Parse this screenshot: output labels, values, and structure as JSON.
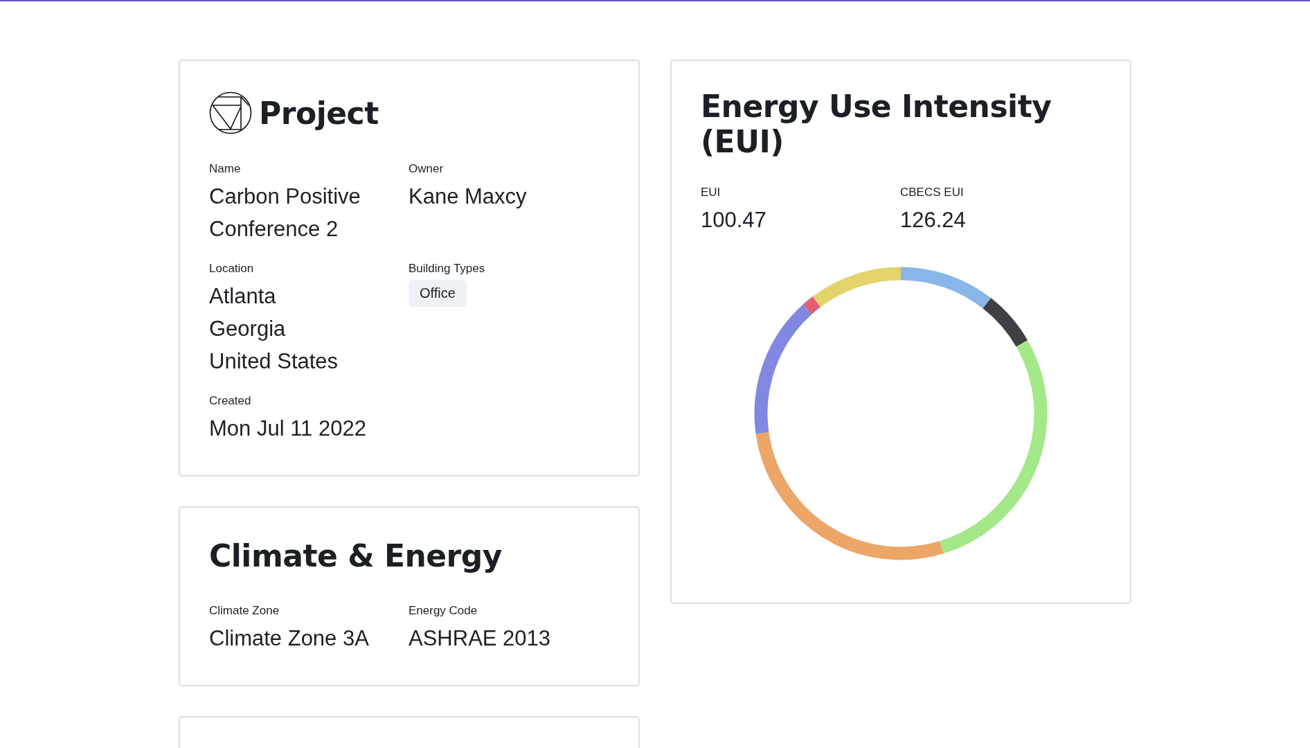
{
  "project": {
    "title": "Project",
    "fields": [
      {
        "label": "Name",
        "lines": [
          "Carbon Positive",
          "Conference 2"
        ]
      },
      {
        "label": "Owner",
        "lines": [
          "Kane Maxcy"
        ]
      },
      {
        "label": "Location",
        "lines": [
          "Atlanta",
          "Georgia",
          "United States"
        ]
      },
      {
        "label": "Building Types",
        "tags": [
          "Office"
        ]
      },
      {
        "label": "Created",
        "lines": [
          "Mon Jul 11 2022"
        ]
      }
    ]
  },
  "climate": {
    "title": "Climate & Energy",
    "fields": [
      {
        "label": "Climate Zone",
        "lines": [
          "Climate Zone 3A"
        ]
      },
      {
        "label": "Energy Code",
        "lines": [
          "ASHRAE 2013"
        ]
      }
    ]
  },
  "eui": {
    "title": "Energy Use Intensity (EUI)",
    "metrics": [
      {
        "label": "EUI",
        "value": "100.47"
      },
      {
        "label": "CBECS EUI",
        "value": "126.24"
      }
    ]
  }
}
